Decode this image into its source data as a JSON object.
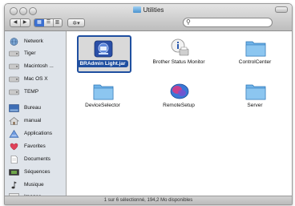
{
  "window": {
    "title": "Utilities"
  },
  "toolbar": {
    "back_glyph": "◀",
    "forward_glyph": "▶",
    "view_icon_glyph": "▦",
    "view_list_glyph": "☰",
    "view_column_glyph": "▥",
    "action_glyph": "✲▾",
    "search_glyph": "⚲",
    "search_placeholder": ""
  },
  "sidebar": {
    "items": [
      {
        "label": "Network",
        "icon": "network-globe-icon"
      },
      {
        "label": "Tiger",
        "icon": "hard-drive-icon"
      },
      {
        "label": "Macintosh ...",
        "icon": "hard-drive-icon"
      },
      {
        "label": "Mac OS X",
        "icon": "hard-drive-icon"
      },
      {
        "label": "TEMP",
        "icon": "hard-drive-icon"
      },
      {
        "label": "Bureau",
        "icon": "desktop-icon"
      },
      {
        "label": "manual",
        "icon": "home-icon"
      },
      {
        "label": "Applications",
        "icon": "applications-icon"
      },
      {
        "label": "Favorites",
        "icon": "heart-icon"
      },
      {
        "label": "Documents",
        "icon": "document-icon"
      },
      {
        "label": "Séquences",
        "icon": "movie-icon"
      },
      {
        "label": "Musique",
        "icon": "music-icon"
      },
      {
        "label": "Images",
        "icon": "picture-icon"
      }
    ]
  },
  "files": [
    {
      "label": "BRAdmin Light.jar",
      "selected": true,
      "icon": "bradmin-java-icon"
    },
    {
      "label": "Brother Status Monitor",
      "selected": false,
      "icon": "status-monitor-icon"
    },
    {
      "label": "ControlCenter",
      "selected": false,
      "icon": "folder-icon"
    },
    {
      "label": "DeviceSelector",
      "selected": false,
      "icon": "folder-icon"
    },
    {
      "label": "RemoteSetup",
      "selected": false,
      "icon": "remote-setup-icon"
    },
    {
      "label": "Server",
      "selected": false,
      "icon": "folder-icon"
    }
  ],
  "status": {
    "text": "1 sur 6 sélectionné, 194,2 Mo disponibles"
  },
  "colors": {
    "selection": "#1f4fa0",
    "sidebar_bg": "#dfe4ea",
    "folder_blue": "#4a93d0"
  }
}
